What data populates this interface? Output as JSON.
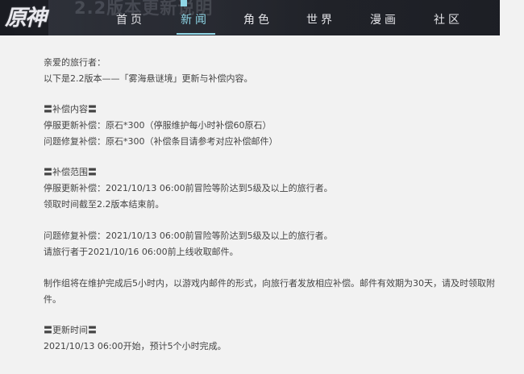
{
  "header": {
    "logo_text": "原神",
    "banner_text": "2.2版本更新说明",
    "nav": [
      {
        "label": "首页"
      },
      {
        "label": "新闻"
      },
      {
        "label": "角色"
      },
      {
        "label": "世界"
      },
      {
        "label": "漫画"
      },
      {
        "label": "社区"
      }
    ]
  },
  "article": {
    "greeting": "亲爱的旅行者：",
    "intro": "以下是2.2版本——「雾海悬谜境」更新与补偿内容。",
    "sec1_title": "〓补偿内容〓",
    "sec1_line1": "停服更新补偿：原石*300（停服维护每小时补偿60原石）",
    "sec1_line2": "问题修复补偿：原石*300（补偿条目请参考对应补偿邮件）",
    "sec2_title": "〓补偿范围〓",
    "sec2_line1": "停服更新补偿：2021/10/13 06:00前冒险等阶达到5级及以上的旅行者。",
    "sec2_line2": "领取时间截至2.2版本结束前。",
    "sec2_line3": "问题修复补偿：2021/10/13 06:00前冒险等阶达到5级及以上的旅行者。",
    "sec2_line4": "请旅行者于2021/10/16 06:00前上线收取邮件。",
    "note": "制作组将在维护完成后5小时内，以游戏内邮件的形式，向旅行者发放相应补偿。邮件有效期为30天，请及时领取附件。",
    "sec3_title": "〓更新时间〓",
    "sec3_line1": "2021/10/13 06:00开始，预计5个小时完成。"
  },
  "colors": {
    "accent": "#8fd6e6",
    "header_bg": "#1f2127",
    "page_bg": "#f2f2f2",
    "text": "#444444"
  }
}
